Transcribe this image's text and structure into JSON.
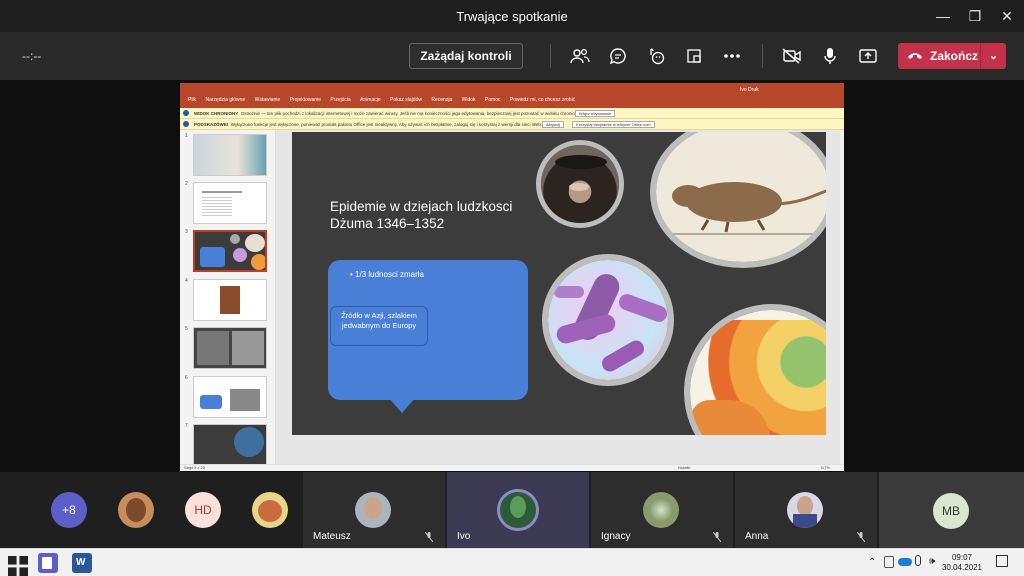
{
  "window": {
    "title": "Trwające spotkanie"
  },
  "toolbar": {
    "timer": "--:--",
    "request_control_label": "Zażądaj kontroli",
    "end_label": "Zakończ"
  },
  "powerpoint": {
    "file_tab": "Plik",
    "tabs": [
      "Narzędzia główne",
      "Wstawianie",
      "Projektowanie",
      "Przejścia",
      "Animacje",
      "Pokaz slajdów",
      "Recenzja",
      "Widok",
      "Pomoc",
      "Powiedz mi, co chcesz zrobić"
    ],
    "user_name": "Ivo Druk",
    "banner1_title": "WIDOK CHRONIONY",
    "banner1_text": "Ostrożnie — ten plik pochodzi z lokalizacji internetowej i może zawierać wirusy. Jeśli nie ma konieczności jego edytowania, bezpieczniej jest pozostać w widoku chronionym.",
    "banner1_button": "Włącz edytowanie",
    "banner2_title": "PODSKAZÓWKI",
    "banner2_text": "Wyłączono funkcje jest wyłączone, ponieważ produkt pakietu Office jest nieaktywny. Aby używać ich bezpłatnie, zaloguj się i korzystaj z wersji dla sieci Web.",
    "banner2_button1": "Aktywuj",
    "banner2_button2": "Korzystaj bezpłatnie w witrynie Office.com",
    "thumb_numbers": [
      "1",
      "2",
      "3",
      "4",
      "5",
      "6",
      "7"
    ],
    "status_left": "Slajd 3 z 23",
    "status_notes": "Notatki",
    "status_zoom": "117%"
  },
  "slide": {
    "title_line1": "Epidemie w dziejach ludzkosci",
    "title_line2": "Dżuma 1346–1352",
    "bullet": "1/3 ludnosci zmarła",
    "box_text": "Źródło w Azji, szlakiem jedwabnym do Europy"
  },
  "participants": {
    "overflow_count": "+8",
    "initials_hd": "HD",
    "initials_mb": "MB",
    "tiles": [
      {
        "name": "Mateusz"
      },
      {
        "name": "Ivo"
      },
      {
        "name": "Ignacy"
      },
      {
        "name": "Anna"
      }
    ]
  },
  "taskbar": {
    "time": "09:07",
    "date": "30.04.2021"
  },
  "colors": {
    "accent_end": "#c4314b",
    "ppt_red": "#b7472a",
    "slide_bg": "#3c3c3c",
    "callout_blue": "#4a7fd8"
  }
}
